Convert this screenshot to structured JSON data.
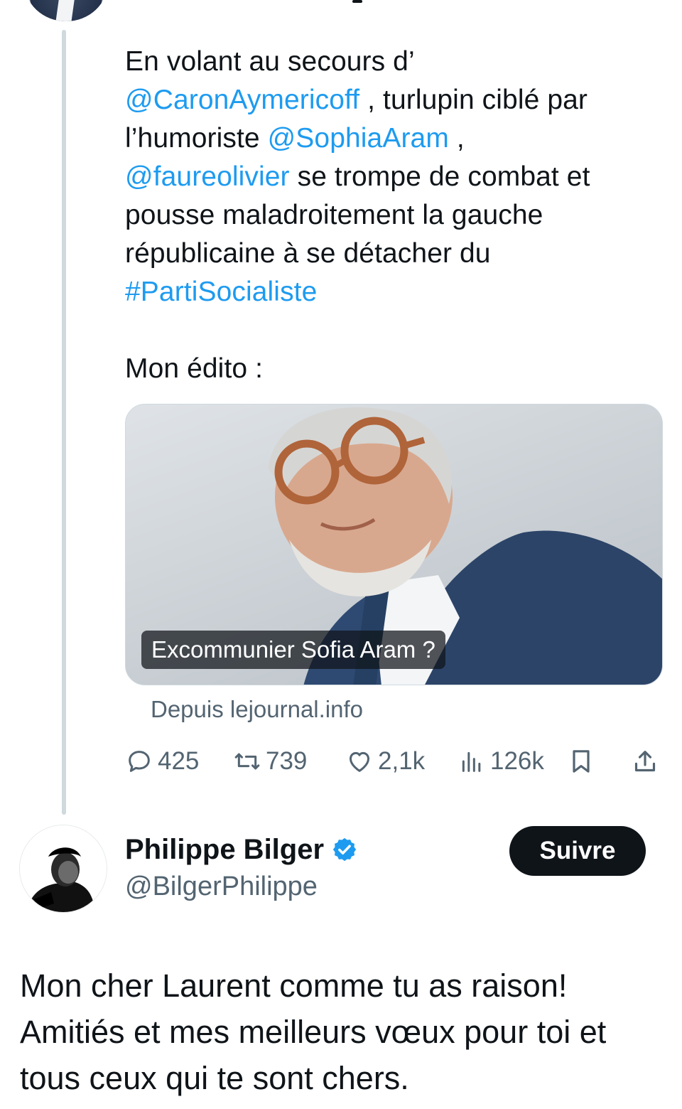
{
  "tweet": {
    "line1_text": "En volant au secours d’",
    "mention_caron": "@CaronAymericoff",
    "text_after_caron": "  , turlupin ciblé par l’humoriste ",
    "mention_sophia": "@SophiaAram",
    "text_after_sophia": " ,",
    "mention_faure": "@faureolivier",
    "text_after_faure": "   se trompe de combat et pousse maladroitement la gauche républicaine à se détacher du ",
    "hashtag": "#PartiSocialiste",
    "paragraph2": "Mon édito :"
  },
  "link_card": {
    "caption": "Excommunier Sofia Aram ?",
    "source": "Depuis lejournal.info"
  },
  "actions": {
    "replies": "425",
    "retweets": "739",
    "likes": "2,1k",
    "views": "126k"
  },
  "reply": {
    "author_name": "Philippe Bilger",
    "author_handle": "@BilgerPhilippe",
    "follow_label": "Suivre",
    "text": "Mon cher Laurent comme tu as raison! Amitiés et mes meilleurs vœux pour toi et tous ceux qui te sont chers."
  },
  "colors": {
    "link": "#1d9bf0",
    "text": "#0f1419",
    "secondary": "#536471",
    "thread_line": "#cfd9de"
  }
}
